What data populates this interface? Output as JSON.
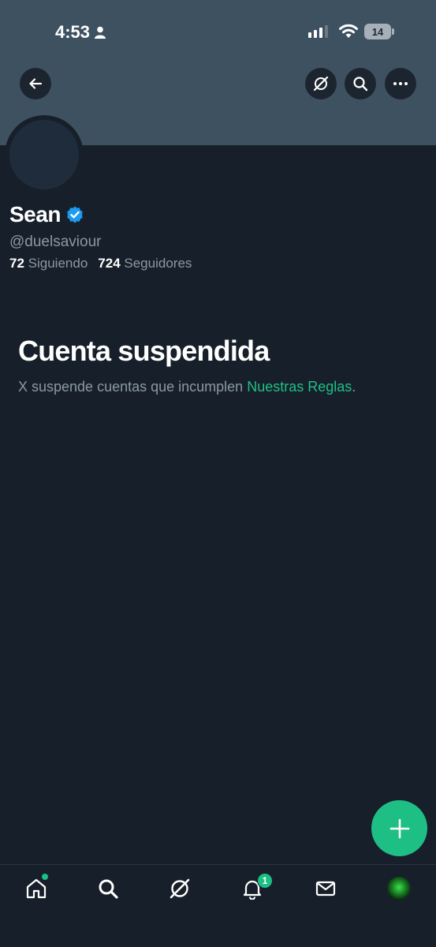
{
  "status_bar": {
    "time": "4:53",
    "battery": "14"
  },
  "profile": {
    "name": "Sean",
    "handle": "@duelsaviour",
    "following_count": "72",
    "following_label": "Siguiendo",
    "followers_count": "724",
    "followers_label": "Seguidores"
  },
  "suspended": {
    "title": "Cuenta suspendida",
    "text": "X suspende cuentas que incumplen ",
    "link": "Nuestras Reglas",
    "suffix": "."
  },
  "tabs": {
    "notifications_badge": "1"
  },
  "colors": {
    "accent": "#1dbf85",
    "banner": "#3e5161",
    "background": "#17202a"
  }
}
